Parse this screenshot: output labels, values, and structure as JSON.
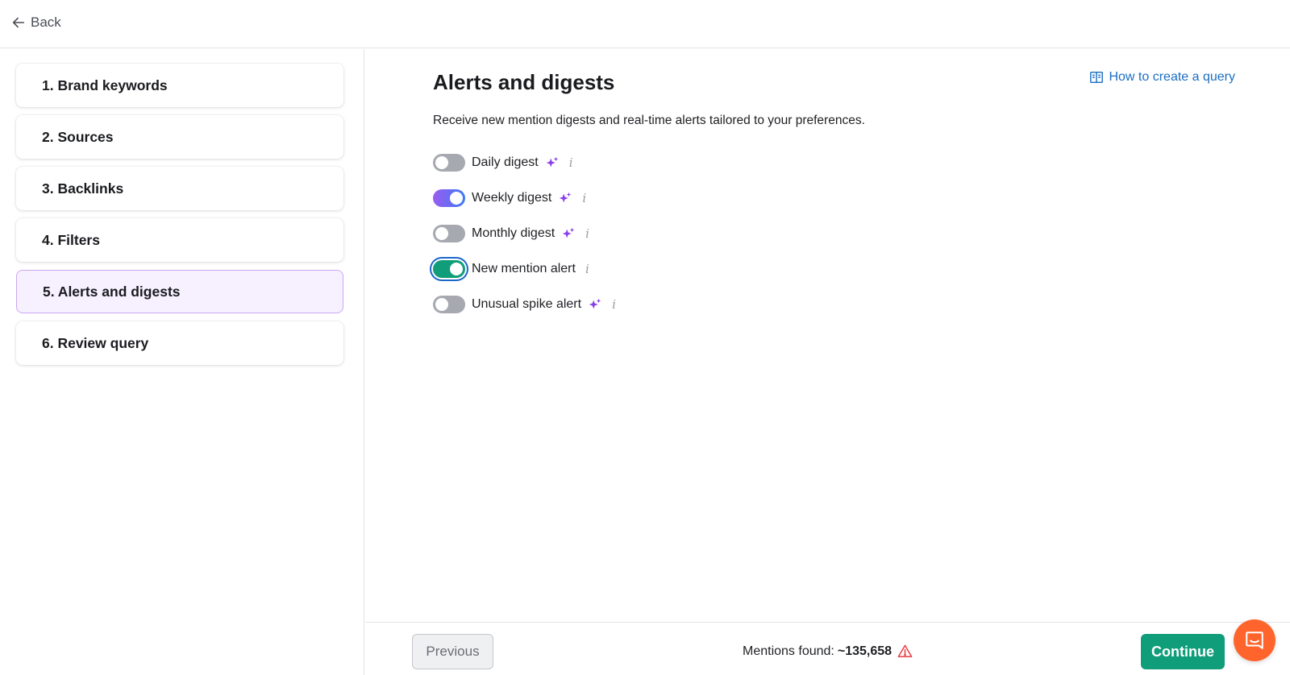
{
  "header": {
    "back_label": "Back"
  },
  "sidebar": {
    "steps": [
      {
        "label": "1. Brand keywords"
      },
      {
        "label": "2. Sources"
      },
      {
        "label": "3. Backlinks"
      },
      {
        "label": "4. Filters"
      },
      {
        "label": "5. Alerts and digests",
        "active": true
      },
      {
        "label": "6. Review query"
      }
    ]
  },
  "main": {
    "title": "Alerts and digests",
    "help_link": "How to create a query",
    "description": "Receive new mention digests and real-time alerts tailored to your preferences.",
    "options": [
      {
        "label": "Daily digest",
        "enabled": false,
        "premium": true
      },
      {
        "label": "Weekly digest",
        "enabled": true,
        "premium": true
      },
      {
        "label": "Monthly digest",
        "enabled": false,
        "premium": true
      },
      {
        "label": "New mention alert",
        "enabled": true,
        "premium": false
      },
      {
        "label": "Unusual spike alert",
        "enabled": false,
        "premium": true
      }
    ]
  },
  "footer": {
    "previous_label": "Previous",
    "mentions_label": "Mentions found:",
    "mentions_count": "~135,658",
    "continue_label": "Continue"
  },
  "colors": {
    "accent_green": "#0f9d7a",
    "accent_violet": "#9b5cf0",
    "link_blue": "#1b6ec2",
    "warning_red": "#e5484d",
    "chat_orange": "#ff642d"
  }
}
